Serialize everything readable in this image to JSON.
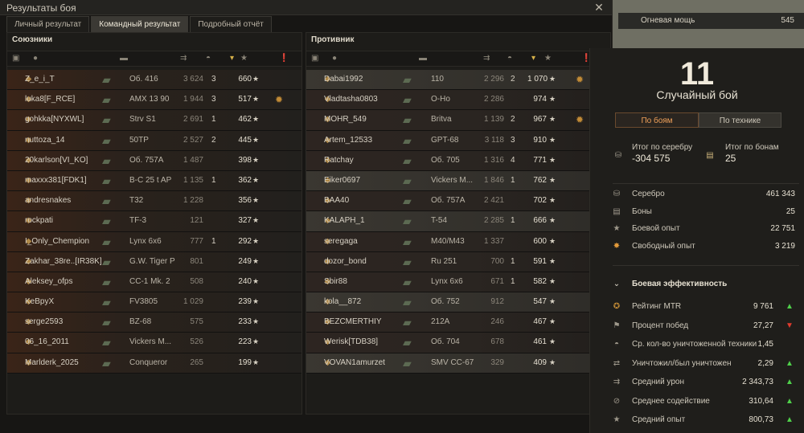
{
  "window": {
    "title": "Результаты боя",
    "close": "✕"
  },
  "tabs": [
    "Личный результат",
    "Командный результат",
    "Подробный отчёт"
  ],
  "allies": {
    "title": "Союзники",
    "rows": [
      {
        "name": "Z_e_i_T",
        "tank": "Об. 416",
        "dmg": "3 624",
        "kills": "3",
        "xp": "660",
        "hl": false
      },
      {
        "name": "luka8[F_RCE]",
        "tank": "AMX 13 90",
        "dmg": "1 944",
        "kills": "3",
        "xp": "517",
        "hl": false
      },
      {
        "name": "gohkka[NYXWL]",
        "tank": "Strv S1",
        "dmg": "2 691",
        "kills": "1",
        "xp": "462",
        "hl": false
      },
      {
        "name": "nuttoza_14",
        "tank": "50TP",
        "dmg": "2 527",
        "kills": "2",
        "xp": "445",
        "hl": false
      },
      {
        "name": "20karlson[VI_KO]",
        "tank": "Об. 757А",
        "dmg": "1 487",
        "kills": "",
        "xp": "398",
        "hl": false
      },
      {
        "name": "maxxx381[FDK1]",
        "tank": "B-C 25 t AP",
        "dmg": "1 135",
        "kills": "1",
        "xp": "362",
        "hl": false
      },
      {
        "name": "andresnakes",
        "tank": "T32",
        "dmg": "1 228",
        "kills": "",
        "xp": "356",
        "hl": false
      },
      {
        "name": "rockpati",
        "tank": "TF-3",
        "dmg": "121",
        "kills": "",
        "xp": "327",
        "hl": false
      },
      {
        "name": "I_Only_Chempion",
        "tank": "Lynx 6x6",
        "dmg": "777",
        "kills": "1",
        "xp": "292",
        "hl": false
      },
      {
        "name": "Zakhar_38re..[IR38K]",
        "tank": "G.W. Tiger P",
        "dmg": "801",
        "kills": "",
        "xp": "249",
        "hl": false
      },
      {
        "name": "Aleksey_ofps",
        "tank": "CC-1 Mk. 2",
        "dmg": "508",
        "kills": "",
        "xp": "240",
        "hl": false
      },
      {
        "name": "KeBpyX",
        "tank": "FV3805",
        "dmg": "1 029",
        "kills": "",
        "xp": "239",
        "hl": false
      },
      {
        "name": "serge2593",
        "tank": "BZ-68",
        "dmg": "575",
        "kills": "",
        "xp": "233",
        "hl": false
      },
      {
        "name": "06_16_2011",
        "tank": "Vickers M...",
        "dmg": "526",
        "kills": "",
        "xp": "223",
        "hl": false
      },
      {
        "name": "Marlderk_2025",
        "tank": "Conqueror",
        "dmg": "265",
        "kills": "",
        "xp": "199",
        "hl": false
      }
    ]
  },
  "enemies": {
    "title": "Противник",
    "rows": [
      {
        "name": "Dabai1992",
        "tank": "110",
        "dmg": "2 296",
        "kills": "2",
        "xp": "1 070",
        "hl": true
      },
      {
        "name": "Vladtasha0803",
        "tank": "O-Ho",
        "dmg": "2 286",
        "kills": "",
        "xp": "974",
        "hl": false
      },
      {
        "name": "MOHR_549",
        "tank": "Britva",
        "dmg": "1 139",
        "kills": "2",
        "xp": "967",
        "hl": false
      },
      {
        "name": "Artem_12533",
        "tank": "GPT-68",
        "dmg": "3 118",
        "kills": "3",
        "xp": "910",
        "hl": false
      },
      {
        "name": "Ratchay",
        "tank": "Об. 705",
        "dmg": "1 316",
        "kills": "4",
        "xp": "771",
        "hl": false
      },
      {
        "name": "Eiker0697",
        "tank": "Vickers M...",
        "dmg": "1 846",
        "kills": "1",
        "xp": "762",
        "hl": true
      },
      {
        "name": "BAA40",
        "tank": "Об. 757А",
        "dmg": "2 421",
        "kills": "",
        "xp": "702",
        "hl": false
      },
      {
        "name": "KALAPH_1",
        "tank": "T-54",
        "dmg": "2 285",
        "kills": "1",
        "xp": "666",
        "hl": true
      },
      {
        "name": "seregaga",
        "tank": "M40/M43",
        "dmg": "1 337",
        "kills": "",
        "xp": "600",
        "hl": false
      },
      {
        "name": "dozor_bond",
        "tank": "Ru 251",
        "dmg": "700",
        "kills": "1",
        "xp": "591",
        "hl": false
      },
      {
        "name": "Sbir88",
        "tank": "Lynx 6x6",
        "dmg": "671",
        "kills": "1",
        "xp": "582",
        "hl": false
      },
      {
        "name": "kola__872",
        "tank": "Об. 752",
        "dmg": "912",
        "kills": "",
        "xp": "547",
        "hl": true
      },
      {
        "name": "BEZCMERTHIY",
        "tank": "212A",
        "dmg": "246",
        "kills": "",
        "xp": "467",
        "hl": false
      },
      {
        "name": "Werisk[TDB38]",
        "tank": "Об. 704",
        "dmg": "678",
        "kills": "",
        "xp": "461",
        "hl": false
      },
      {
        "name": "VOVAN1amurzet",
        "tank": "SMV CC-67",
        "dmg": "329",
        "kills": "",
        "xp": "409",
        "hl": true
      }
    ]
  },
  "topbar": {
    "label": "Огневая мощь",
    "value": "545"
  },
  "summary": {
    "number": "11",
    "battle_type": "Случайный бой",
    "switch": [
      "По боям",
      "По технике"
    ],
    "silver_total_label": "Итог по серебру",
    "silver_total": "-304 575",
    "bonds_total_label": "Итог по бонам",
    "bonds_total": "25",
    "stats": [
      {
        "label": "Серебро",
        "value": "461 343"
      },
      {
        "label": "Боны",
        "value": "25"
      },
      {
        "label": "Боевой опыт",
        "value": "22 751"
      },
      {
        "label": "Свободный опыт",
        "value": "3 219"
      }
    ],
    "eff_title": "Боевая эффективность",
    "eff": [
      {
        "label": "Рейтинг MTR",
        "value": "9 761",
        "trend": "up"
      },
      {
        "label": "Процент побед",
        "value": "27,27",
        "trend": "down"
      },
      {
        "label": "Ср. кол-во уничтоженной техники",
        "value": "1,45",
        "trend": ""
      },
      {
        "label": "Уничтожил/был уничтожен",
        "value": "2,29",
        "trend": "up"
      },
      {
        "label": "Средний урон",
        "value": "2 343,73",
        "trend": "up"
      },
      {
        "label": "Среднее содействие",
        "value": "310,64",
        "trend": "up"
      },
      {
        "label": "Средний опыт",
        "value": "800,73",
        "trend": "up"
      }
    ]
  }
}
